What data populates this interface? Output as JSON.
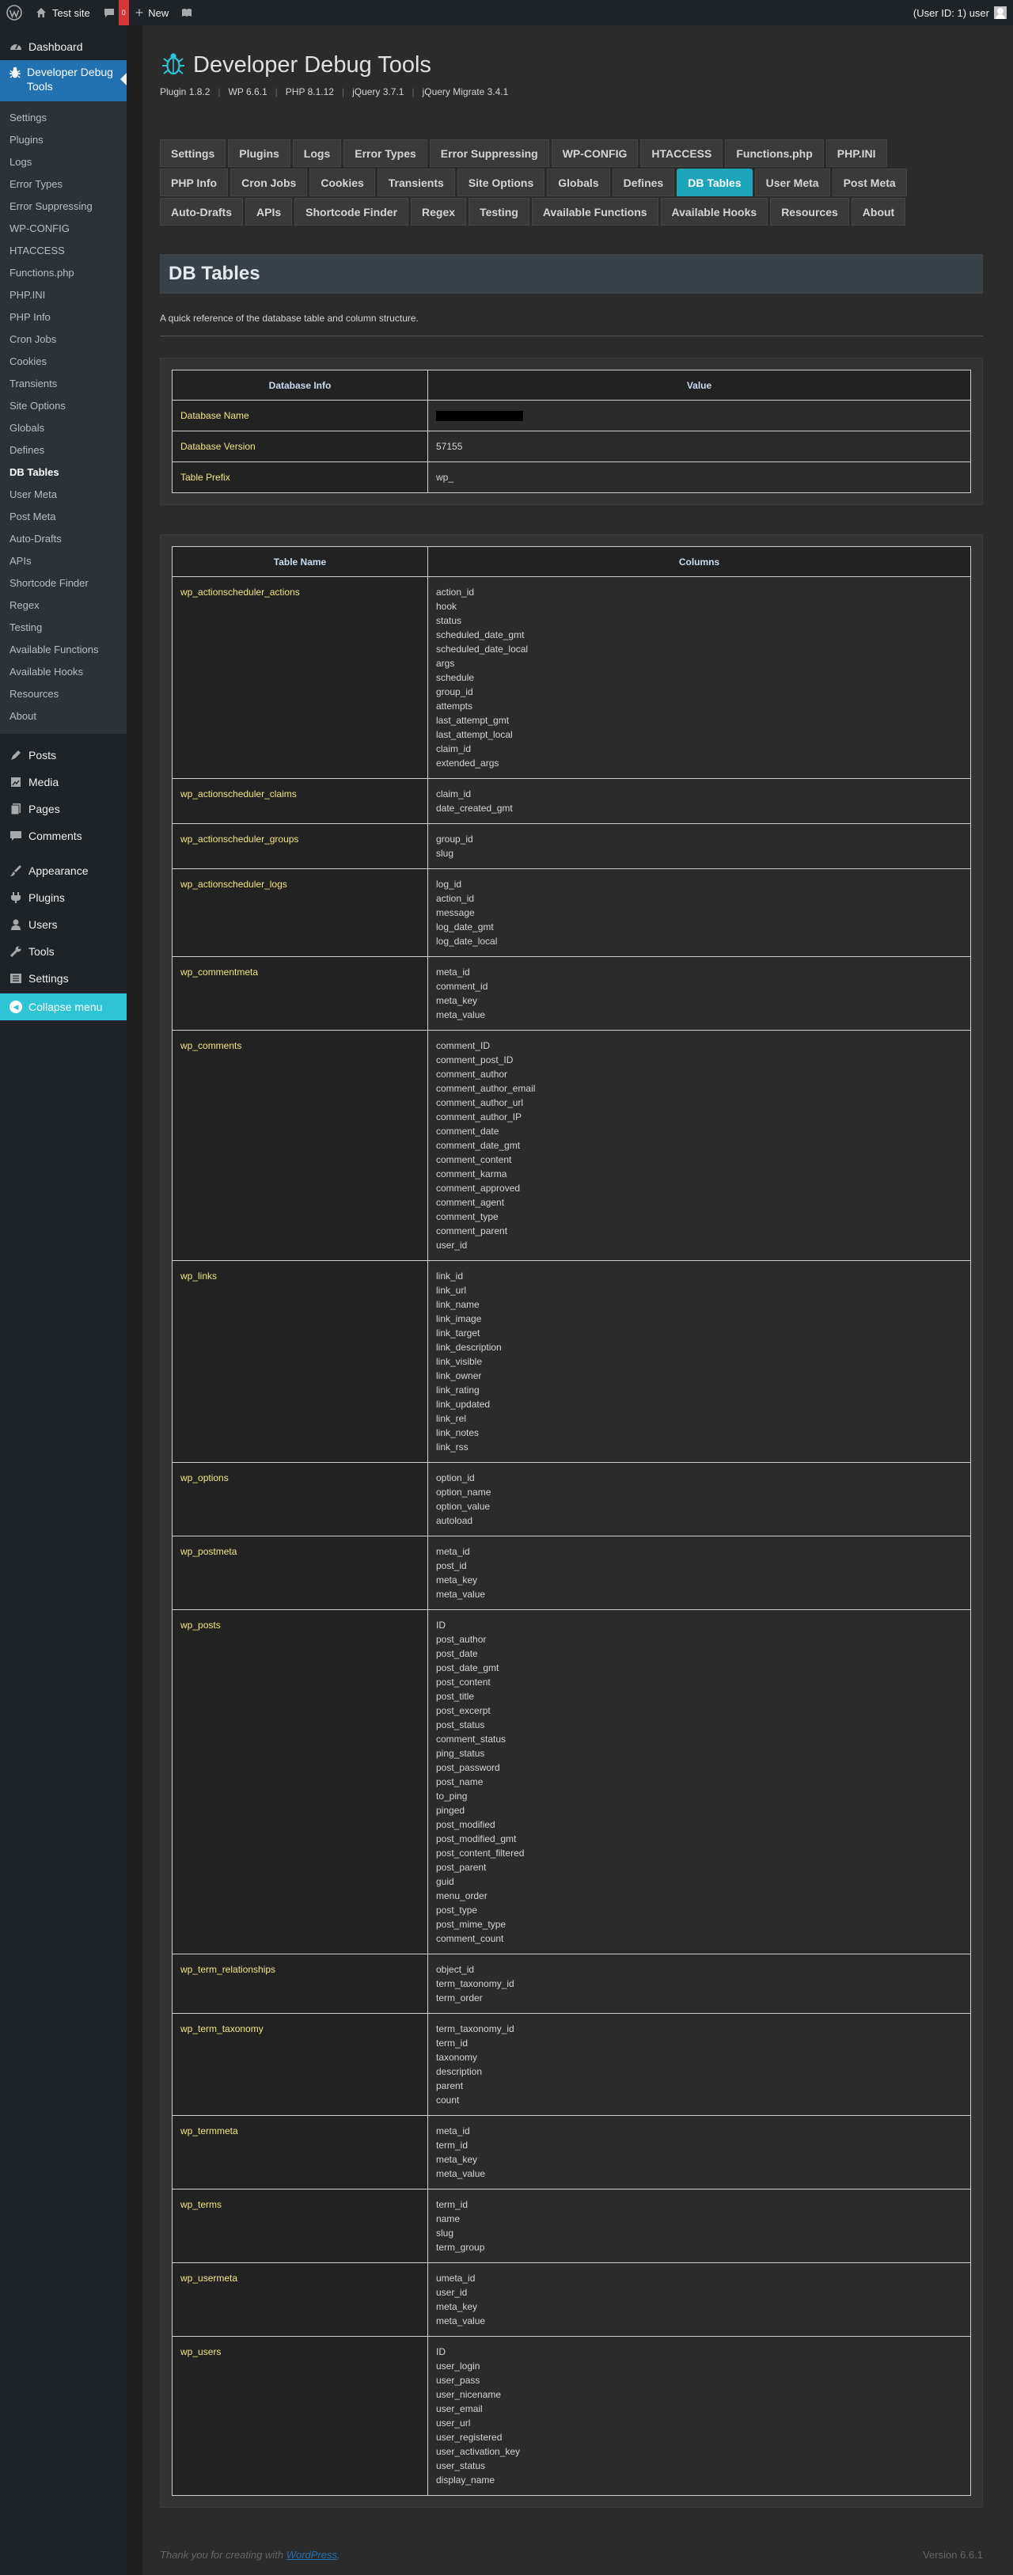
{
  "adminbar": {
    "site_name": "Test site",
    "comments_count": "0",
    "new_label": "New",
    "user_label": "(User ID: 1) user"
  },
  "sidebar": {
    "dashboard": "Dashboard",
    "plugin_menu": "Developer Debug Tools",
    "submenu": [
      "Settings",
      "Plugins",
      "Logs",
      "Error Types",
      "Error Suppressing",
      "WP-CONFIG",
      "HTACCESS",
      "Functions.php",
      "PHP.INI",
      "PHP Info",
      "Cron Jobs",
      "Cookies",
      "Transients",
      "Site Options",
      "Globals",
      "Defines",
      "DB Tables",
      "User Meta",
      "Post Meta",
      "Auto-Drafts",
      "APIs",
      "Shortcode Finder",
      "Regex",
      "Testing",
      "Available Functions",
      "Available Hooks",
      "Resources",
      "About"
    ],
    "menu": [
      "Posts",
      "Media",
      "Pages",
      "Comments",
      "Appearance",
      "Plugins",
      "Users",
      "Tools",
      "Settings"
    ],
    "collapse": "Collapse menu"
  },
  "header": {
    "title": "Developer Debug Tools",
    "versions": [
      "Plugin 1.8.2",
      "WP 6.6.1",
      "PHP 8.1.12",
      "jQuery 3.7.1",
      "jQuery Migrate 3.4.1"
    ]
  },
  "tabs": [
    [
      "Settings",
      "Plugins",
      "Logs",
      "Error Types",
      "Error Suppressing",
      "WP-CONFIG",
      "HTACCESS",
      "Functions.php",
      "PHP.INI"
    ],
    [
      "PHP Info",
      "Cron Jobs",
      "Cookies",
      "Transients",
      "Site Options",
      "Globals",
      "Defines",
      "DB Tables",
      "User Meta",
      "Post Meta"
    ],
    [
      "Auto-Drafts",
      "APIs",
      "Shortcode Finder",
      "Regex",
      "Testing",
      "Available Functions",
      "Available Hooks",
      "Resources",
      "About"
    ]
  ],
  "active_tab": "DB Tables",
  "page": {
    "title": "DB Tables",
    "description": "A quick reference of the database table and column structure."
  },
  "db_info": {
    "headers": [
      "Database Info",
      "Value"
    ],
    "rows": [
      {
        "label": "Database Name",
        "value": ""
      },
      {
        "label": "Database Version",
        "value": "57155"
      },
      {
        "label": "Table Prefix",
        "value": "wp_"
      }
    ]
  },
  "db_tables": {
    "headers": [
      "Table Name",
      "Columns"
    ],
    "rows": [
      {
        "name": "wp_actionscheduler_actions",
        "columns": [
          "action_id",
          "hook",
          "status",
          "scheduled_date_gmt",
          "scheduled_date_local",
          "args",
          "schedule",
          "group_id",
          "attempts",
          "last_attempt_gmt",
          "last_attempt_local",
          "claim_id",
          "extended_args"
        ]
      },
      {
        "name": "wp_actionscheduler_claims",
        "columns": [
          "claim_id",
          "date_created_gmt"
        ]
      },
      {
        "name": "wp_actionscheduler_groups",
        "columns": [
          "group_id",
          "slug"
        ]
      },
      {
        "name": "wp_actionscheduler_logs",
        "columns": [
          "log_id",
          "action_id",
          "message",
          "log_date_gmt",
          "log_date_local"
        ]
      },
      {
        "name": "wp_commentmeta",
        "columns": [
          "meta_id",
          "comment_id",
          "meta_key",
          "meta_value"
        ]
      },
      {
        "name": "wp_comments",
        "columns": [
          "comment_ID",
          "comment_post_ID",
          "comment_author",
          "comment_author_email",
          "comment_author_url",
          "comment_author_IP",
          "comment_date",
          "comment_date_gmt",
          "comment_content",
          "comment_karma",
          "comment_approved",
          "comment_agent",
          "comment_type",
          "comment_parent",
          "user_id"
        ]
      },
      {
        "name": "wp_links",
        "columns": [
          "link_id",
          "link_url",
          "link_name",
          "link_image",
          "link_target",
          "link_description",
          "link_visible",
          "link_owner",
          "link_rating",
          "link_updated",
          "link_rel",
          "link_notes",
          "link_rss"
        ]
      },
      {
        "name": "wp_options",
        "columns": [
          "option_id",
          "option_name",
          "option_value",
          "autoload"
        ]
      },
      {
        "name": "wp_postmeta",
        "columns": [
          "meta_id",
          "post_id",
          "meta_key",
          "meta_value"
        ]
      },
      {
        "name": "wp_posts",
        "columns": [
          "ID",
          "post_author",
          "post_date",
          "post_date_gmt",
          "post_content",
          "post_title",
          "post_excerpt",
          "post_status",
          "comment_status",
          "ping_status",
          "post_password",
          "post_name",
          "to_ping",
          "pinged",
          "post_modified",
          "post_modified_gmt",
          "post_content_filtered",
          "post_parent",
          "guid",
          "menu_order",
          "post_type",
          "post_mime_type",
          "comment_count"
        ]
      },
      {
        "name": "wp_term_relationships",
        "columns": [
          "object_id",
          "term_taxonomy_id",
          "term_order"
        ]
      },
      {
        "name": "wp_term_taxonomy",
        "columns": [
          "term_taxonomy_id",
          "term_id",
          "taxonomy",
          "description",
          "parent",
          "count"
        ]
      },
      {
        "name": "wp_termmeta",
        "columns": [
          "meta_id",
          "term_id",
          "meta_key",
          "meta_value"
        ]
      },
      {
        "name": "wp_terms",
        "columns": [
          "term_id",
          "name",
          "slug",
          "term_group"
        ]
      },
      {
        "name": "wp_usermeta",
        "columns": [
          "umeta_id",
          "user_id",
          "meta_key",
          "meta_value"
        ]
      },
      {
        "name": "wp_users",
        "columns": [
          "ID",
          "user_login",
          "user_pass",
          "user_nicename",
          "user_email",
          "user_url",
          "user_registered",
          "user_activation_key",
          "user_status",
          "display_name"
        ]
      }
    ]
  },
  "footer": {
    "thanks_prefix": "Thank you for creating with ",
    "wordpress_link": "WordPress",
    "thanks_suffix": ".",
    "version": "Version 6.6.1"
  }
}
